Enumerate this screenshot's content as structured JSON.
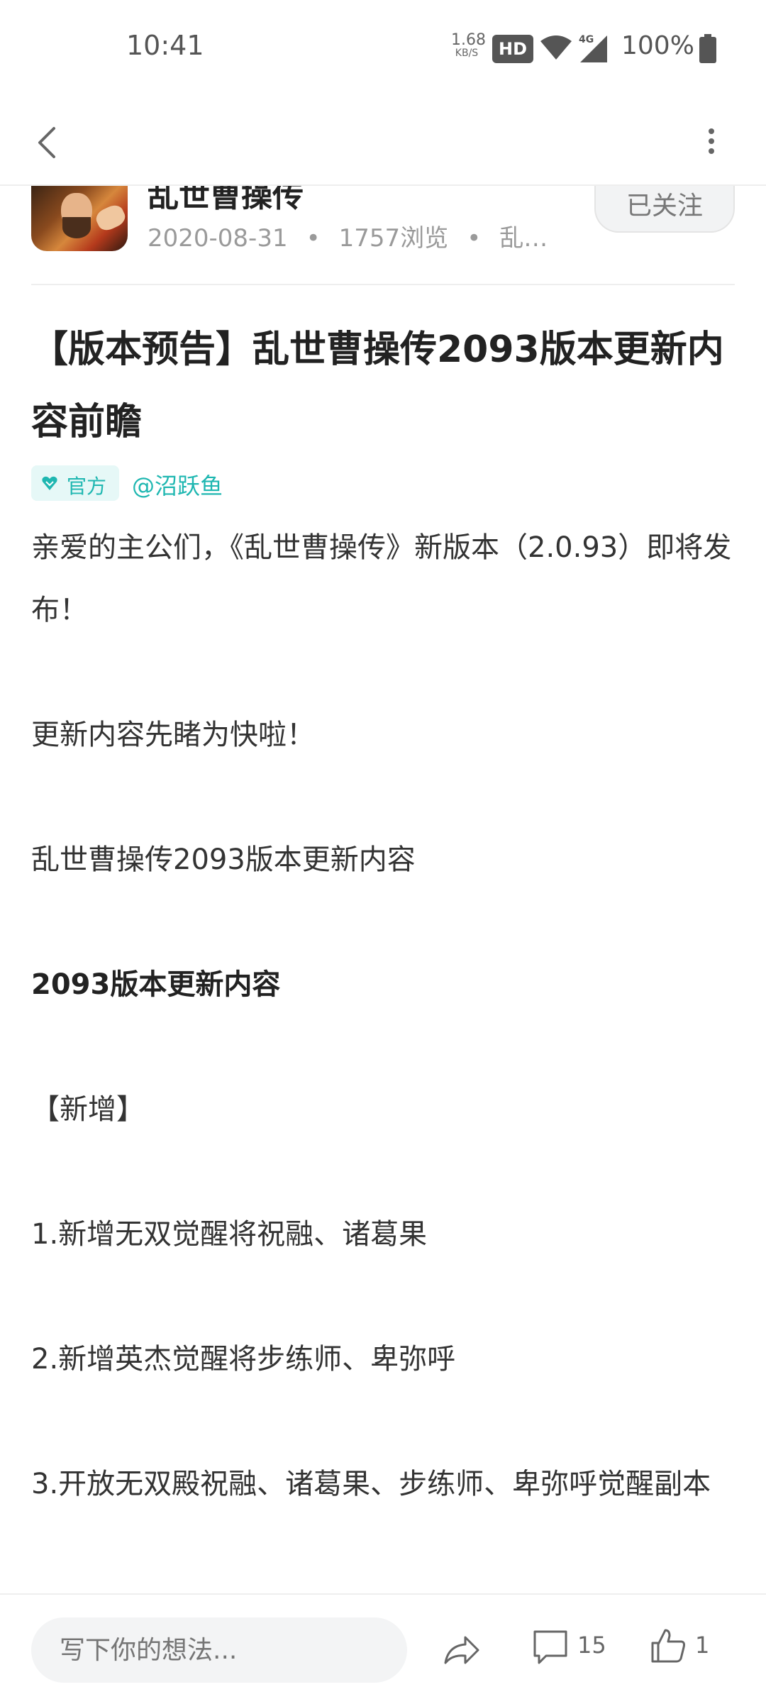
{
  "status_bar": {
    "time": "10:41",
    "net_speed": "1.68",
    "net_unit": "KB/S",
    "hd": "HD",
    "network": "4G",
    "battery": "100%"
  },
  "author": {
    "name": "乱世曹操传",
    "date": "2020-08-31",
    "views": "1757浏览",
    "game": "乱…",
    "follow_label": "已关注"
  },
  "article": {
    "title": "【版本预告】乱世曹操传2093版本更新内容前瞻",
    "official_label": "官方",
    "mention": "@沼跃鱼",
    "body": {
      "p1": "亲爱的主公们，《乱世曹操传》新版本（2.0.93）即将发布！",
      "p2": "更新内容先睹为快啦！",
      "p3": "乱世曹操传2093版本更新内容",
      "p4": "2093版本更新内容",
      "p5": "【新增】",
      "p6": "1.新增无双觉醒将祝融、诸葛果",
      "p7": "2.新增英杰觉醒将步练师、卑弥呼",
      "p8": "3.开放无双殿祝融、诸葛果、步练师、卑弥呼觉醒副本"
    }
  },
  "bottom_bar": {
    "comment_placeholder": "写下你的想法...",
    "comment_count": "15",
    "like_count": "1"
  },
  "colors": {
    "accent": "#1fb7b1",
    "text": "#333333",
    "meta": "#9a9a9a"
  }
}
